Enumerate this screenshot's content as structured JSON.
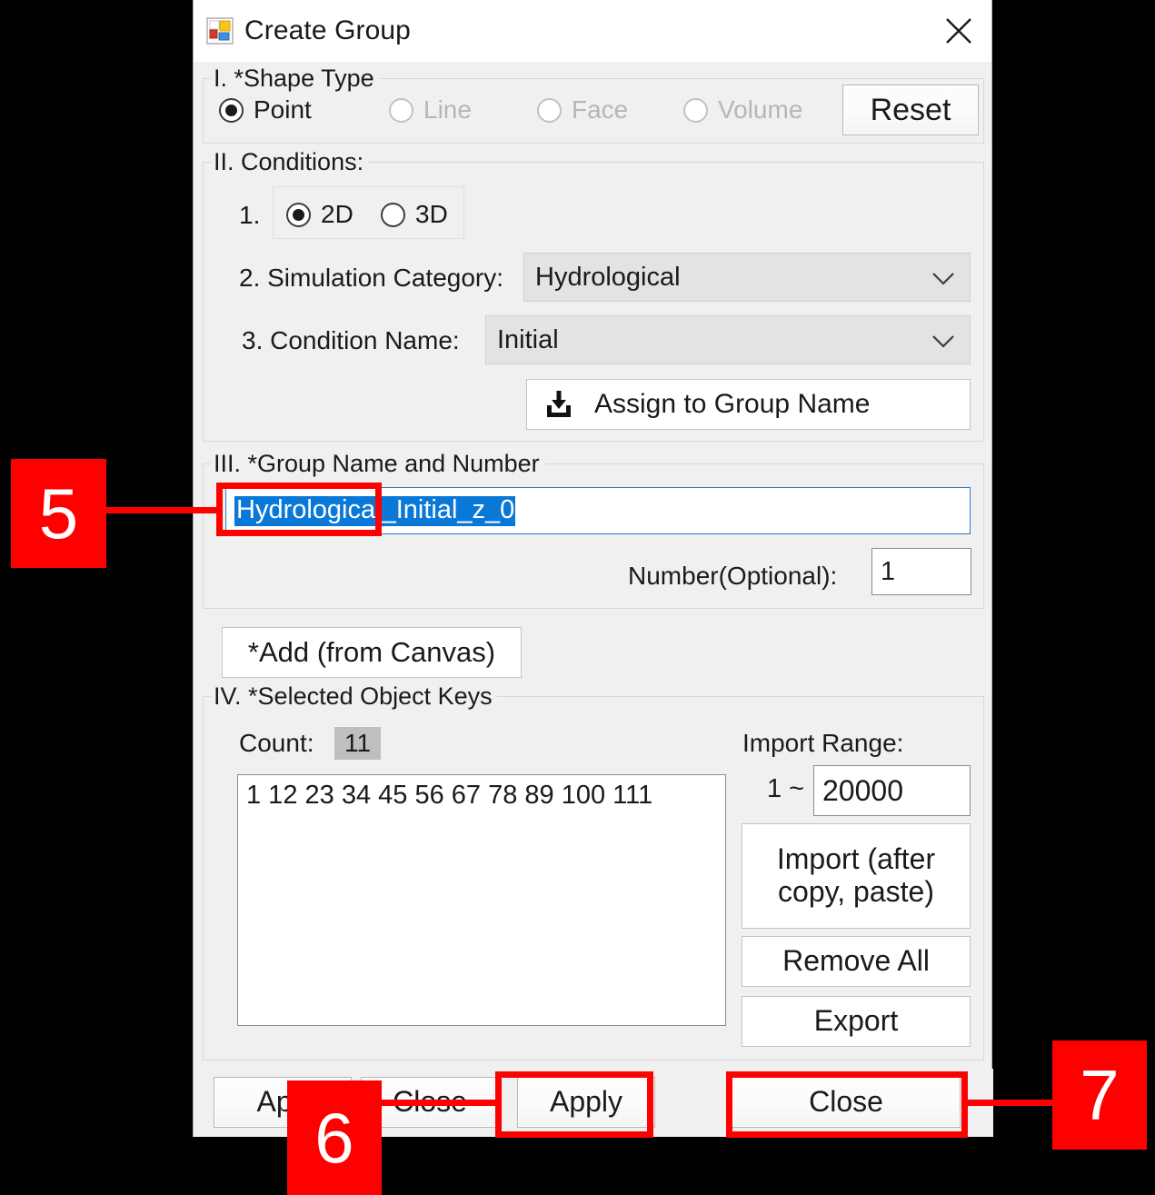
{
  "window": {
    "title": "Create Group",
    "icon": "windows-form-icon",
    "close_icon": "close-icon"
  },
  "section_shape": {
    "legend": "I. *Shape Type",
    "options": [
      {
        "label": "Point",
        "selected": true,
        "enabled": true
      },
      {
        "label": "Line",
        "selected": false,
        "enabled": false
      },
      {
        "label": "Face",
        "selected": false,
        "enabled": false
      },
      {
        "label": "Volume",
        "selected": false,
        "enabled": false
      }
    ],
    "reset_label": "Reset"
  },
  "section_conditions": {
    "legend": "II. Conditions:",
    "item1_number": "1.",
    "dim_options": [
      {
        "label": "2D",
        "selected": true
      },
      {
        "label": "3D",
        "selected": false
      }
    ],
    "item2_label": "2. Simulation Category:",
    "simulation_category_value": "Hydrological",
    "item3_label": "3. Condition Name:",
    "condition_name_value": "Initial",
    "assign_button_label": "Assign to Group Name",
    "assign_button_icon": "import-to-tray-icon"
  },
  "section_group": {
    "legend": "III. *Group Name and Number",
    "group_name_value": "Hydrological_Initial_z_0",
    "group_name_selected": true,
    "number_label": "Number(Optional):",
    "number_value": "1"
  },
  "section_keys": {
    "add_button_label": "*Add (from Canvas)",
    "legend": "IV. *Selected Object Keys",
    "count_label": "Count:",
    "count_value": "11",
    "keys_text": "1 12 23 34 45 56 67 78 89 100 111",
    "keys": [
      "1",
      "12",
      "23",
      "34",
      "45",
      "56",
      "67",
      "78",
      "89",
      "100",
      "111"
    ],
    "import_range_label": "Import Range:",
    "range_from": "1 ~",
    "range_to_value": "20000",
    "import_button_label": "Import (after\ncopy, paste)",
    "import_button_line1": "Import (after",
    "import_button_line2": "copy, paste)",
    "remove_all_label": "Remove All",
    "export_label": "Export"
  },
  "footer": {
    "apply_label": "Apply",
    "close_label": "Close",
    "ghost_apply_label": "App",
    "ghost_close_label": "Close"
  },
  "annotations": [
    {
      "number": "5",
      "target": "group-name-input"
    },
    {
      "number": "6",
      "target": "apply-button"
    },
    {
      "number": "7",
      "target": "close-button"
    }
  ],
  "colors": {
    "annotation_red": "#ff0000",
    "selection_blue": "#0a78d7",
    "dialog_bg": "#f0f0f0",
    "backdrop": "#000000"
  }
}
